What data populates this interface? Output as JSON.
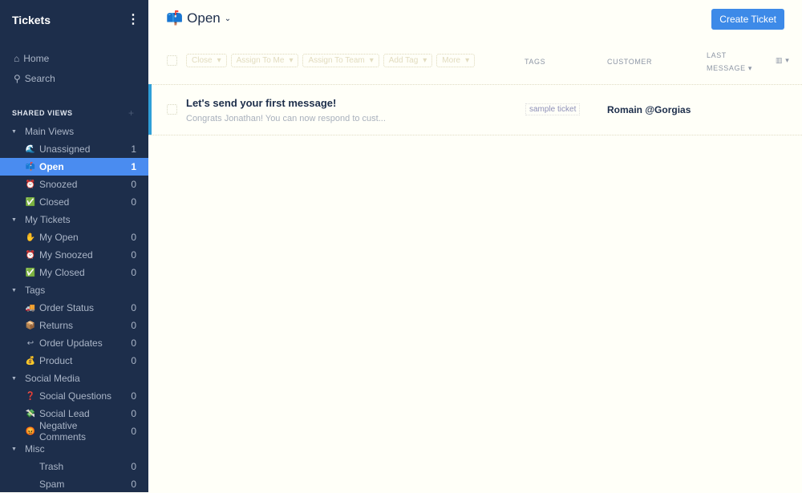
{
  "sidebar": {
    "title": "Tickets",
    "menu_icon": "⋮",
    "nav": [
      {
        "icon": "⌂",
        "label": "Home"
      },
      {
        "icon": "⚲",
        "label": "Search"
      }
    ],
    "section_label": "SHARED VIEWS",
    "add_icon": "+",
    "groups": [
      {
        "label": "Main Views",
        "items": [
          {
            "icon": "🌊",
            "label": "Unassigned",
            "count": "1"
          },
          {
            "icon": "📫",
            "label": "Open",
            "count": "1",
            "selected": true
          },
          {
            "icon": "⏰",
            "label": "Snoozed",
            "count": "0"
          },
          {
            "icon": "✅",
            "label": "Closed",
            "count": "0"
          }
        ]
      },
      {
        "label": "My Tickets",
        "items": [
          {
            "icon": "✋",
            "label": "My Open",
            "count": "0"
          },
          {
            "icon": "⏰",
            "label": "My Snoozed",
            "count": "0"
          },
          {
            "icon": "✅",
            "label": "My Closed",
            "count": "0"
          }
        ]
      },
      {
        "label": "Tags",
        "items": [
          {
            "icon": "🚚",
            "label": "Order Status",
            "count": "0"
          },
          {
            "icon": "📦",
            "label": "Returns",
            "count": "0"
          },
          {
            "icon": "↩",
            "label": "Order Updates",
            "count": "0"
          },
          {
            "icon": "💰",
            "label": "Product",
            "count": "0"
          }
        ]
      },
      {
        "label": "Social Media",
        "items": [
          {
            "icon": "❓",
            "label": "Social Questions",
            "count": "0"
          },
          {
            "icon": "💸",
            "label": "Social Lead",
            "count": "0"
          },
          {
            "icon": "😡",
            "label": "Negative Comments",
            "count": "0"
          }
        ]
      },
      {
        "label": "Misc",
        "items": [
          {
            "icon": "",
            "label": "Trash",
            "count": "0"
          },
          {
            "icon": "",
            "label": "Spam",
            "count": "0"
          }
        ]
      }
    ]
  },
  "header": {
    "view_icon": "📫",
    "view_title": "Open",
    "create_label": "Create Ticket"
  },
  "toolbar": {
    "actions": [
      "Close",
      "Assign To Me",
      "Assign To Team",
      "Add Tag",
      "More"
    ]
  },
  "columns": {
    "tags": "TAGS",
    "customer": "CUSTOMER",
    "last_message_1": "LAST",
    "last_message_2": "MESSAGE ▾"
  },
  "tickets": [
    {
      "subject": "Let's send your first message!",
      "preview": "Congrats Jonathan! You can now respond to cust...",
      "tag": "sample ticket",
      "customer": "Romain @Gorgias"
    }
  ]
}
